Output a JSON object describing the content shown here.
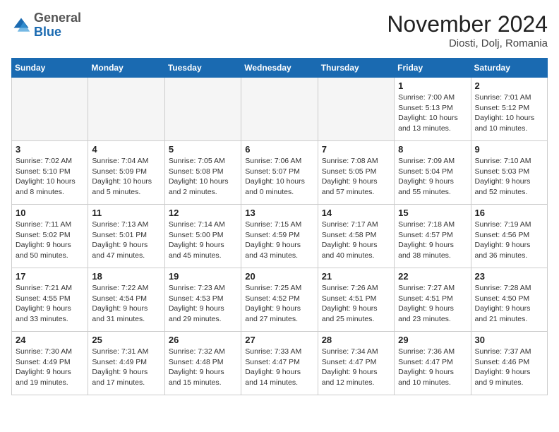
{
  "header": {
    "logo_general": "General",
    "logo_blue": "Blue",
    "month_title": "November 2024",
    "location": "Diosti, Dolj, Romania"
  },
  "days_of_week": [
    "Sunday",
    "Monday",
    "Tuesday",
    "Wednesday",
    "Thursday",
    "Friday",
    "Saturday"
  ],
  "weeks": [
    [
      {
        "day": "",
        "info": ""
      },
      {
        "day": "",
        "info": ""
      },
      {
        "day": "",
        "info": ""
      },
      {
        "day": "",
        "info": ""
      },
      {
        "day": "",
        "info": ""
      },
      {
        "day": "1",
        "info": "Sunrise: 7:00 AM\nSunset: 5:13 PM\nDaylight: 10 hours and 13 minutes."
      },
      {
        "day": "2",
        "info": "Sunrise: 7:01 AM\nSunset: 5:12 PM\nDaylight: 10 hours and 10 minutes."
      }
    ],
    [
      {
        "day": "3",
        "info": "Sunrise: 7:02 AM\nSunset: 5:10 PM\nDaylight: 10 hours and 8 minutes."
      },
      {
        "day": "4",
        "info": "Sunrise: 7:04 AM\nSunset: 5:09 PM\nDaylight: 10 hours and 5 minutes."
      },
      {
        "day": "5",
        "info": "Sunrise: 7:05 AM\nSunset: 5:08 PM\nDaylight: 10 hours and 2 minutes."
      },
      {
        "day": "6",
        "info": "Sunrise: 7:06 AM\nSunset: 5:07 PM\nDaylight: 10 hours and 0 minutes."
      },
      {
        "day": "7",
        "info": "Sunrise: 7:08 AM\nSunset: 5:05 PM\nDaylight: 9 hours and 57 minutes."
      },
      {
        "day": "8",
        "info": "Sunrise: 7:09 AM\nSunset: 5:04 PM\nDaylight: 9 hours and 55 minutes."
      },
      {
        "day": "9",
        "info": "Sunrise: 7:10 AM\nSunset: 5:03 PM\nDaylight: 9 hours and 52 minutes."
      }
    ],
    [
      {
        "day": "10",
        "info": "Sunrise: 7:11 AM\nSunset: 5:02 PM\nDaylight: 9 hours and 50 minutes."
      },
      {
        "day": "11",
        "info": "Sunrise: 7:13 AM\nSunset: 5:01 PM\nDaylight: 9 hours and 47 minutes."
      },
      {
        "day": "12",
        "info": "Sunrise: 7:14 AM\nSunset: 5:00 PM\nDaylight: 9 hours and 45 minutes."
      },
      {
        "day": "13",
        "info": "Sunrise: 7:15 AM\nSunset: 4:59 PM\nDaylight: 9 hours and 43 minutes."
      },
      {
        "day": "14",
        "info": "Sunrise: 7:17 AM\nSunset: 4:58 PM\nDaylight: 9 hours and 40 minutes."
      },
      {
        "day": "15",
        "info": "Sunrise: 7:18 AM\nSunset: 4:57 PM\nDaylight: 9 hours and 38 minutes."
      },
      {
        "day": "16",
        "info": "Sunrise: 7:19 AM\nSunset: 4:56 PM\nDaylight: 9 hours and 36 minutes."
      }
    ],
    [
      {
        "day": "17",
        "info": "Sunrise: 7:21 AM\nSunset: 4:55 PM\nDaylight: 9 hours and 33 minutes."
      },
      {
        "day": "18",
        "info": "Sunrise: 7:22 AM\nSunset: 4:54 PM\nDaylight: 9 hours and 31 minutes."
      },
      {
        "day": "19",
        "info": "Sunrise: 7:23 AM\nSunset: 4:53 PM\nDaylight: 9 hours and 29 minutes."
      },
      {
        "day": "20",
        "info": "Sunrise: 7:25 AM\nSunset: 4:52 PM\nDaylight: 9 hours and 27 minutes."
      },
      {
        "day": "21",
        "info": "Sunrise: 7:26 AM\nSunset: 4:51 PM\nDaylight: 9 hours and 25 minutes."
      },
      {
        "day": "22",
        "info": "Sunrise: 7:27 AM\nSunset: 4:51 PM\nDaylight: 9 hours and 23 minutes."
      },
      {
        "day": "23",
        "info": "Sunrise: 7:28 AM\nSunset: 4:50 PM\nDaylight: 9 hours and 21 minutes."
      }
    ],
    [
      {
        "day": "24",
        "info": "Sunrise: 7:30 AM\nSunset: 4:49 PM\nDaylight: 9 hours and 19 minutes."
      },
      {
        "day": "25",
        "info": "Sunrise: 7:31 AM\nSunset: 4:49 PM\nDaylight: 9 hours and 17 minutes."
      },
      {
        "day": "26",
        "info": "Sunrise: 7:32 AM\nSunset: 4:48 PM\nDaylight: 9 hours and 15 minutes."
      },
      {
        "day": "27",
        "info": "Sunrise: 7:33 AM\nSunset: 4:47 PM\nDaylight: 9 hours and 14 minutes."
      },
      {
        "day": "28",
        "info": "Sunrise: 7:34 AM\nSunset: 4:47 PM\nDaylight: 9 hours and 12 minutes."
      },
      {
        "day": "29",
        "info": "Sunrise: 7:36 AM\nSunset: 4:47 PM\nDaylight: 9 hours and 10 minutes."
      },
      {
        "day": "30",
        "info": "Sunrise: 7:37 AM\nSunset: 4:46 PM\nDaylight: 9 hours and 9 minutes."
      }
    ]
  ]
}
